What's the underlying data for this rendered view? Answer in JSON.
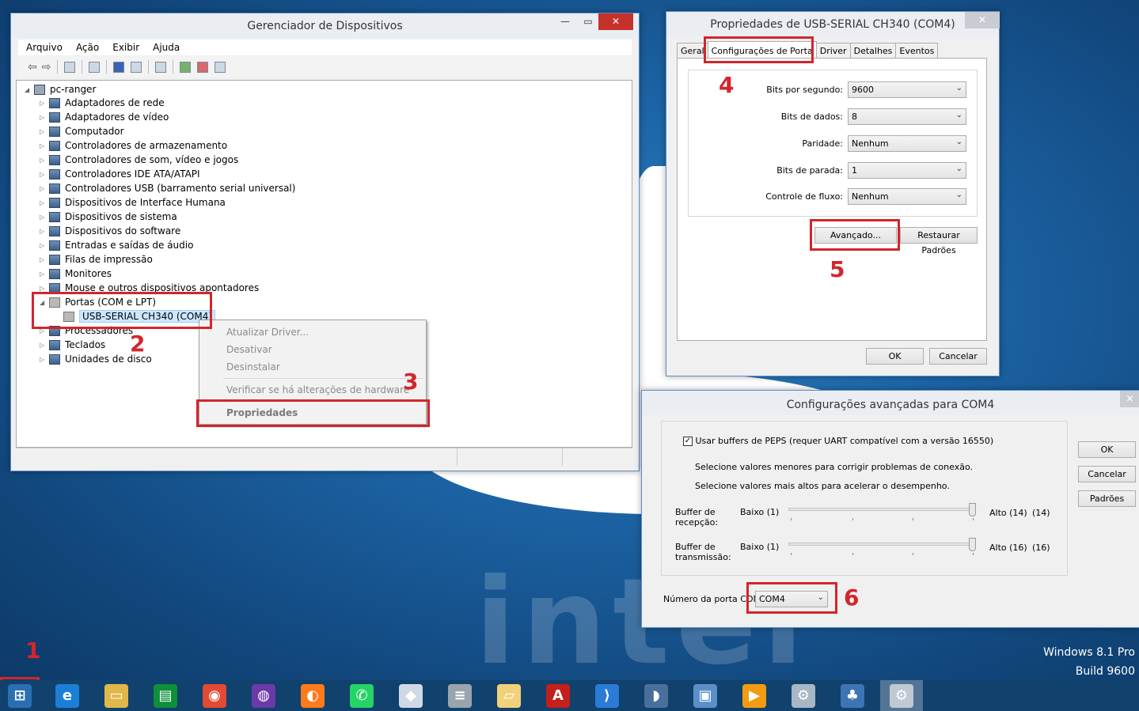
{
  "devmgr": {
    "title": "Gerenciador de Dispositivos",
    "menu": [
      "Arquivo",
      "Ação",
      "Exibir",
      "Ajuda"
    ],
    "root": "pc-ranger",
    "items": [
      "Adaptadores de rede",
      "Adaptadores de vídeo",
      "Computador",
      "Controladores de armazenamento",
      "Controladores de som, vídeo e jogos",
      "Controladores IDE ATA/ATAPI",
      "Controladores USB (barramento serial universal)",
      "Dispositivos de Interface Humana",
      "Dispositivos de sistema",
      "Dispositivos do software",
      "Entradas e saídas de áudio",
      "Filas de impressão",
      "Monitores",
      "Mouse e outros dispositivos apontadores",
      "Portas (COM e LPT)",
      "USB-SERIAL CH340 (COM4)",
      "Processadores",
      "Teclados",
      "Unidades de disco"
    ]
  },
  "context_menu": {
    "items": [
      "Atualizar Driver...",
      "Desativar",
      "Desinstalar",
      "Verificar se há alterações de hardware",
      "Propriedades"
    ]
  },
  "props": {
    "title": "Propriedades de USB-SERIAL CH340 (COM4)",
    "tabs": [
      "Geral",
      "Configurações de Porta",
      "Driver",
      "Detalhes",
      "Eventos"
    ],
    "fields": [
      {
        "label": "Bits por segundo:",
        "value": "9600"
      },
      {
        "label": "Bits de dados:",
        "value": "8"
      },
      {
        "label": "Paridade:",
        "value": "Nenhum"
      },
      {
        "label": "Bits de parada:",
        "value": "1"
      },
      {
        "label": "Controle de fluxo:",
        "value": "Nenhum"
      }
    ],
    "advanced_btn": "Avançado...",
    "restore_btn": "Restaurar Padrões",
    "ok": "OK",
    "cancel": "Cancelar"
  },
  "advanced": {
    "title": "Configurações avançadas para COM4",
    "checkbox_label": "Usar buffers de PEPS (requer UART compatível com a versão 16550)",
    "checked": true,
    "hint1": "Selecione valores menores para corrigir problemas de conexão.",
    "hint2": "Selecione valores mais altos para acelerar o desempenho.",
    "rx_label": "Buffer de recepção:",
    "tx_label": "Buffer de transmissão:",
    "low_rx": "Baixo (1)",
    "high_rx": "Alto (14)",
    "cur_rx": "(14)",
    "low_tx": "Baixo (1)",
    "high_tx": "Alto (16)",
    "cur_tx": "(16)",
    "rx_level": 1.0,
    "tx_level": 1.0,
    "com_label": "Número da porta COM:",
    "com_value": "COM4",
    "ok": "OK",
    "cancel": "Cancelar",
    "defaults": "Padrões"
  },
  "annotations": [
    "1",
    "2",
    "3",
    "4",
    "5",
    "6"
  ],
  "watermark": {
    "line1": "Windows 8.1 Pro",
    "line2": "Build 9600"
  },
  "taskbar": [
    "start-icon",
    "ie-icon",
    "explorer-icon",
    "store-icon",
    "chrome-icon",
    "github-icon",
    "firefox-icon",
    "whatsapp-icon",
    "virtualbox-icon",
    "database-icon",
    "folder-icon",
    "acrobat-icon",
    "vscode-icon",
    "mysql-icon",
    "photos-icon",
    "media-icon",
    "device-manager-icon",
    "python-icon",
    "device-manager-active-icon"
  ],
  "colors": {
    "accent_red": "#d3252b",
    "taskbar": "#11416d",
    "desktop": "#1d66a8"
  }
}
